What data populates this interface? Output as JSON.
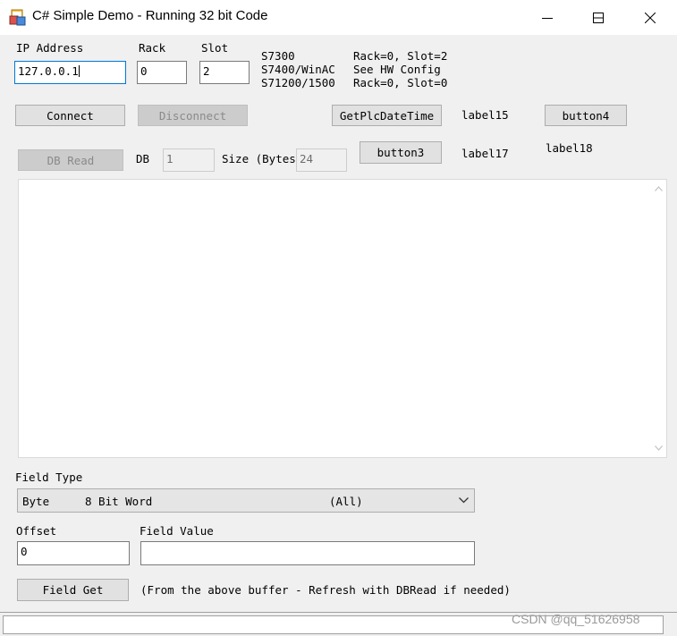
{
  "window": {
    "title": "C# Simple Demo - Running 32 bit Code",
    "app_icon": "windows-form-icon",
    "controls": {
      "minimize": "minimize-icon",
      "maximize": "maximize-icon",
      "close": "close-icon"
    }
  },
  "connection": {
    "ip_label": "IP Address",
    "ip_value": "127.0.0.1",
    "rack_label": "Rack",
    "rack_value": "0",
    "slot_label": "Slot",
    "slot_value": "2",
    "hints": {
      "models": [
        "S7300",
        "S7400/WinAC",
        "S71200/1500"
      ],
      "configs": [
        "Rack=0, Slot=2",
        "See HW Config",
        "Rack=0, Slot=0"
      ]
    },
    "connect_label": "Connect",
    "disconnect_label": "Disconnect",
    "getdatetime_label": "GetPlcDateTime",
    "label15": "label15",
    "button4_label": "button4"
  },
  "db": {
    "dbread_label": "DB Read",
    "db_label": "DB",
    "db_value": "1",
    "size_label": "Size (Bytes)",
    "size_value": "24",
    "button3_label": "button3",
    "label17": "label17",
    "label18": "label18"
  },
  "output": {
    "text": ""
  },
  "field": {
    "type_label": "Field Type",
    "type_selected_name": "Byte",
    "type_selected_desc": "8 Bit Word",
    "type_selected_range": "(All)",
    "offset_label": "Offset",
    "offset_value": "0",
    "value_label": "Field Value",
    "value_value": "",
    "fieldget_label": "Field Get",
    "fieldget_note": "(From the above buffer - Refresh with DBRead if needed)"
  },
  "watermark": "CSDN @qq_51626958",
  "colors": {
    "accent": "#0078d7",
    "window_bg": "#f0f0f0",
    "button_bg": "#e1e1e1"
  }
}
